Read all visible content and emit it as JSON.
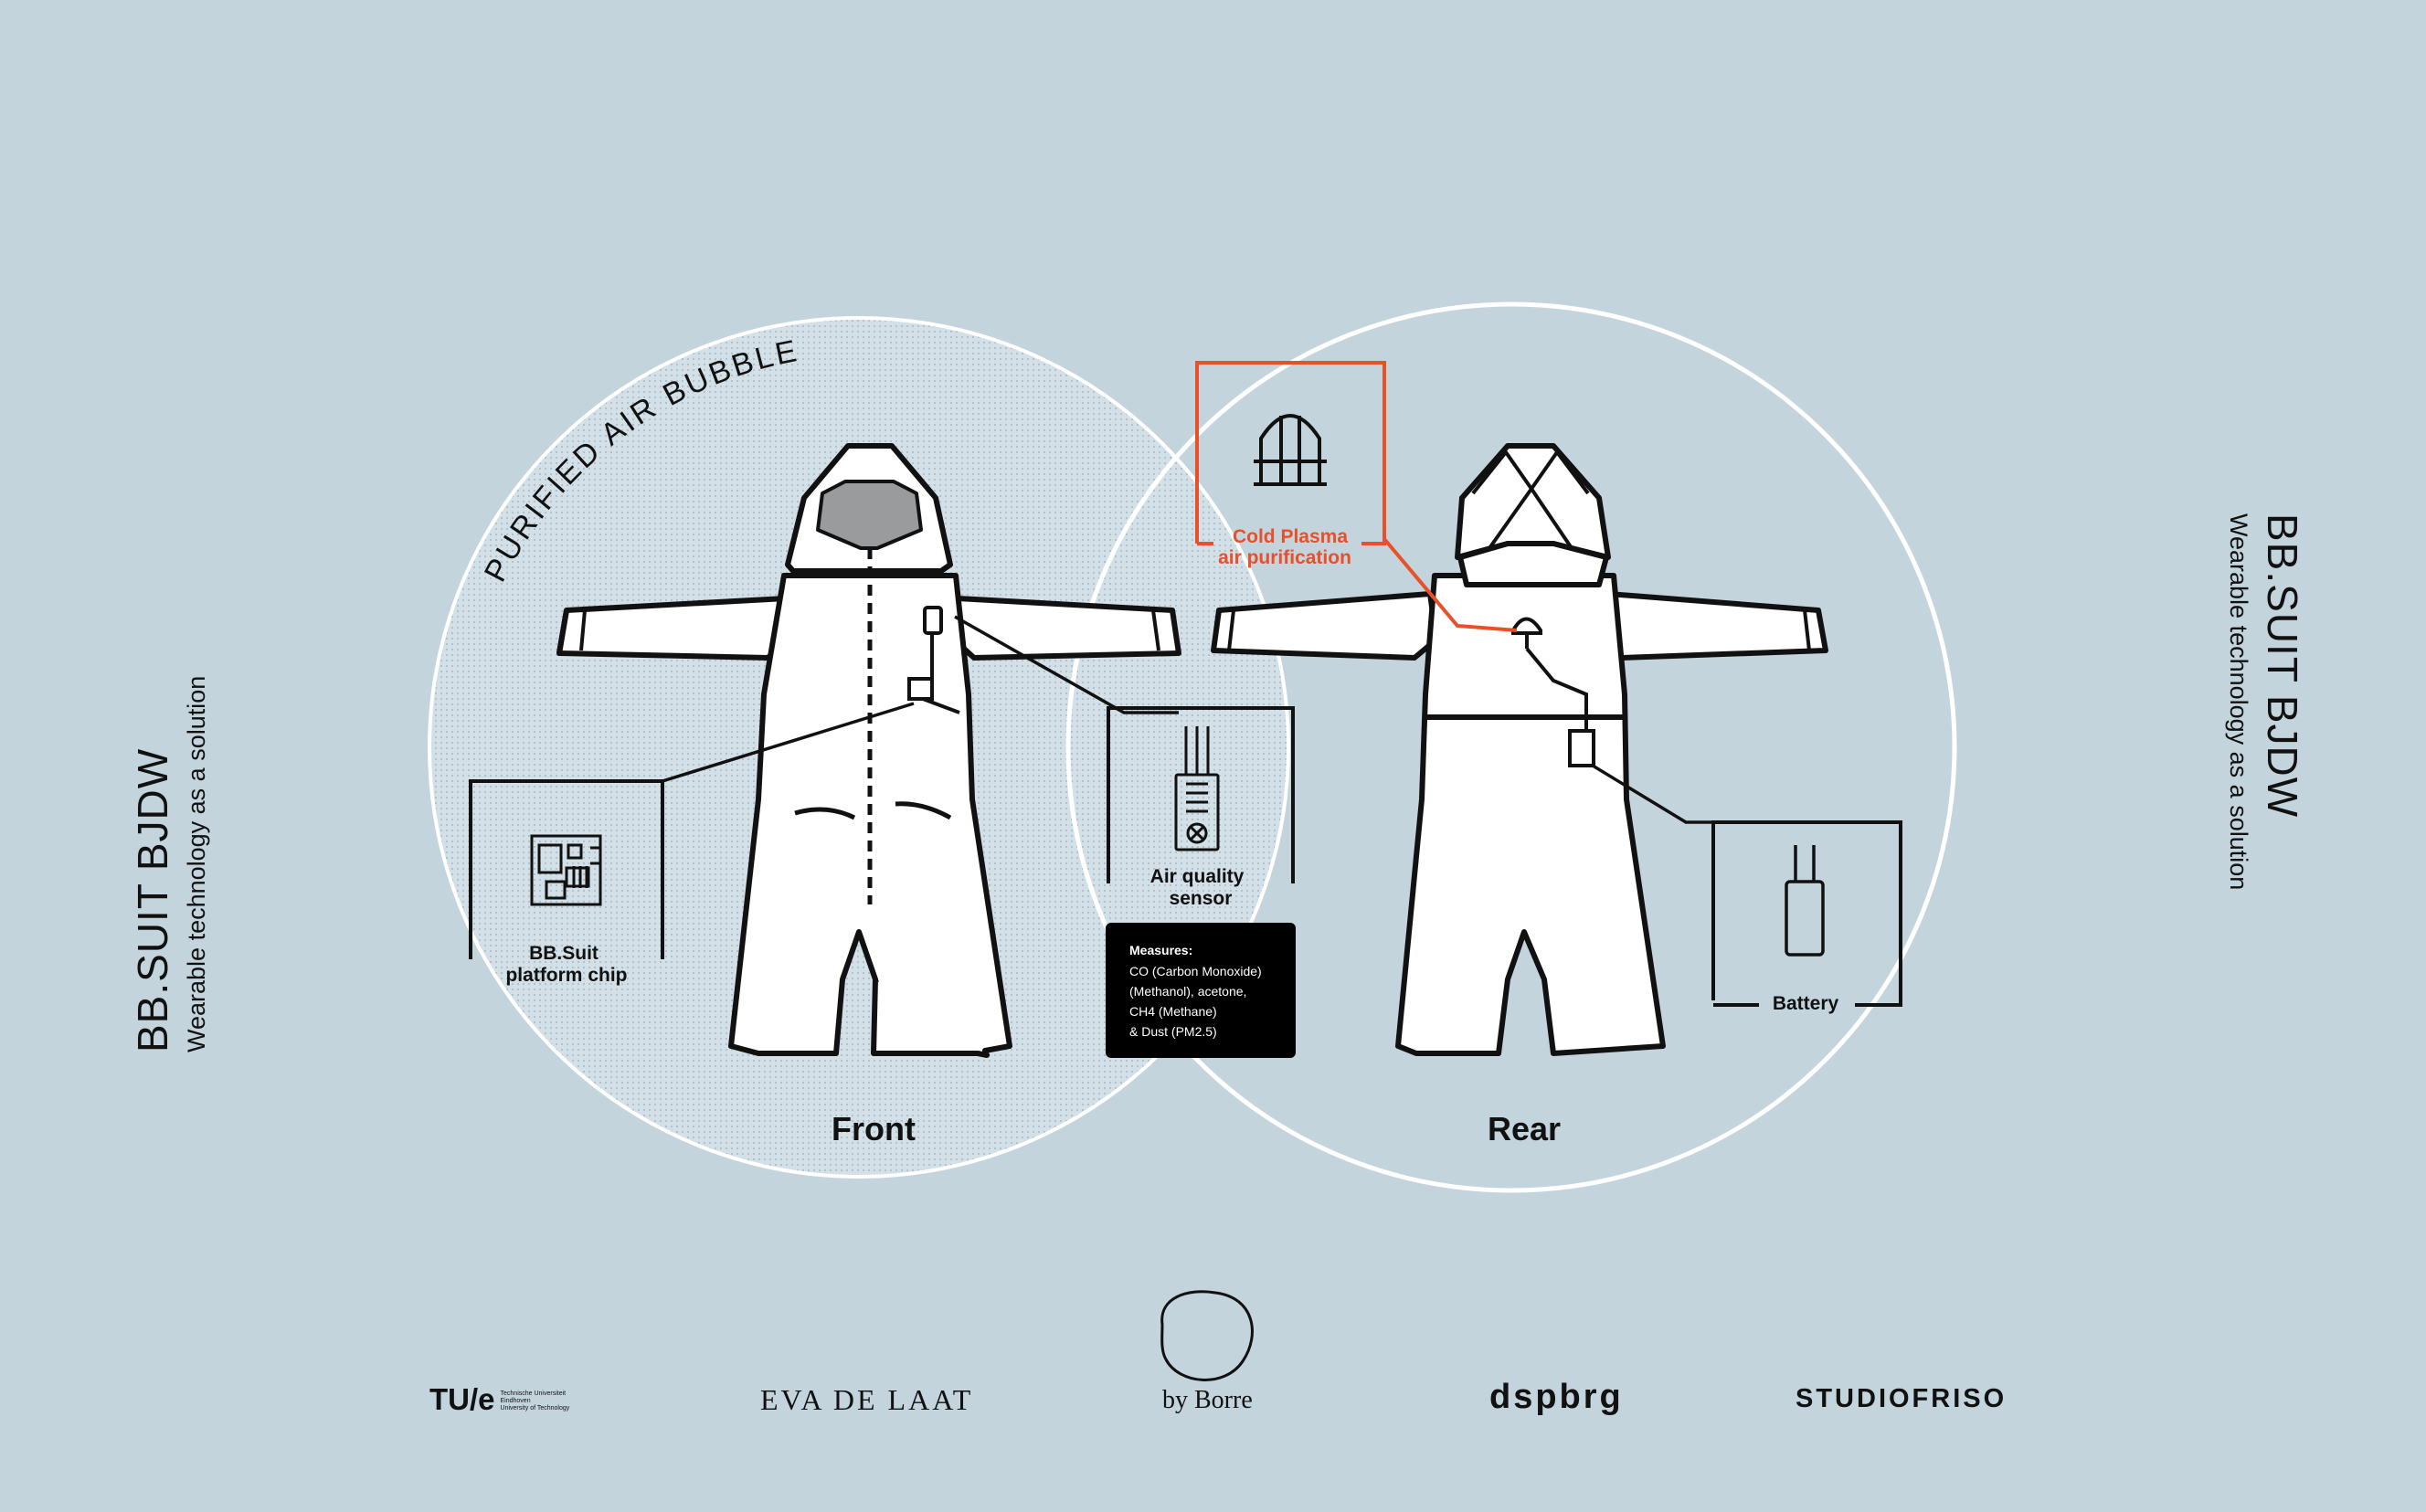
{
  "side_title": {
    "title": "BB.SUIT BJDW",
    "subtitle": "Wearable technology as a solution"
  },
  "bubble_label": "PURIFIED AIR BUBBLE",
  "views": {
    "front": "Front",
    "rear": "Rear"
  },
  "callouts": {
    "chip": [
      "BB.Suit",
      "platform chip"
    ],
    "sensor": [
      "Air quality",
      "sensor"
    ],
    "plasma": [
      "Cold Plasma",
      "air purification"
    ],
    "battery": "Battery"
  },
  "measures": {
    "heading": "Measures:",
    "lines": [
      "CO (Carbon Monoxide)",
      "(Methanol), acetone,",
      "CH4 (Methane)",
      "& Dust (PM2.5)"
    ]
  },
  "logos": {
    "tue": "TU/e",
    "tue_sub": [
      "Technische Universiteit",
      "Eindhoven",
      "University of Technology"
    ],
    "eva": "EVA DE LAAT",
    "borre": "by Borre",
    "dspbrg": "dspbrg",
    "friso": "STUDIOFRISO"
  },
  "colors": {
    "background": "#c3d4dd",
    "accent": "#e8502a",
    "line": "#111111",
    "suit": "#ffffff",
    "measures_box": "#000000"
  }
}
